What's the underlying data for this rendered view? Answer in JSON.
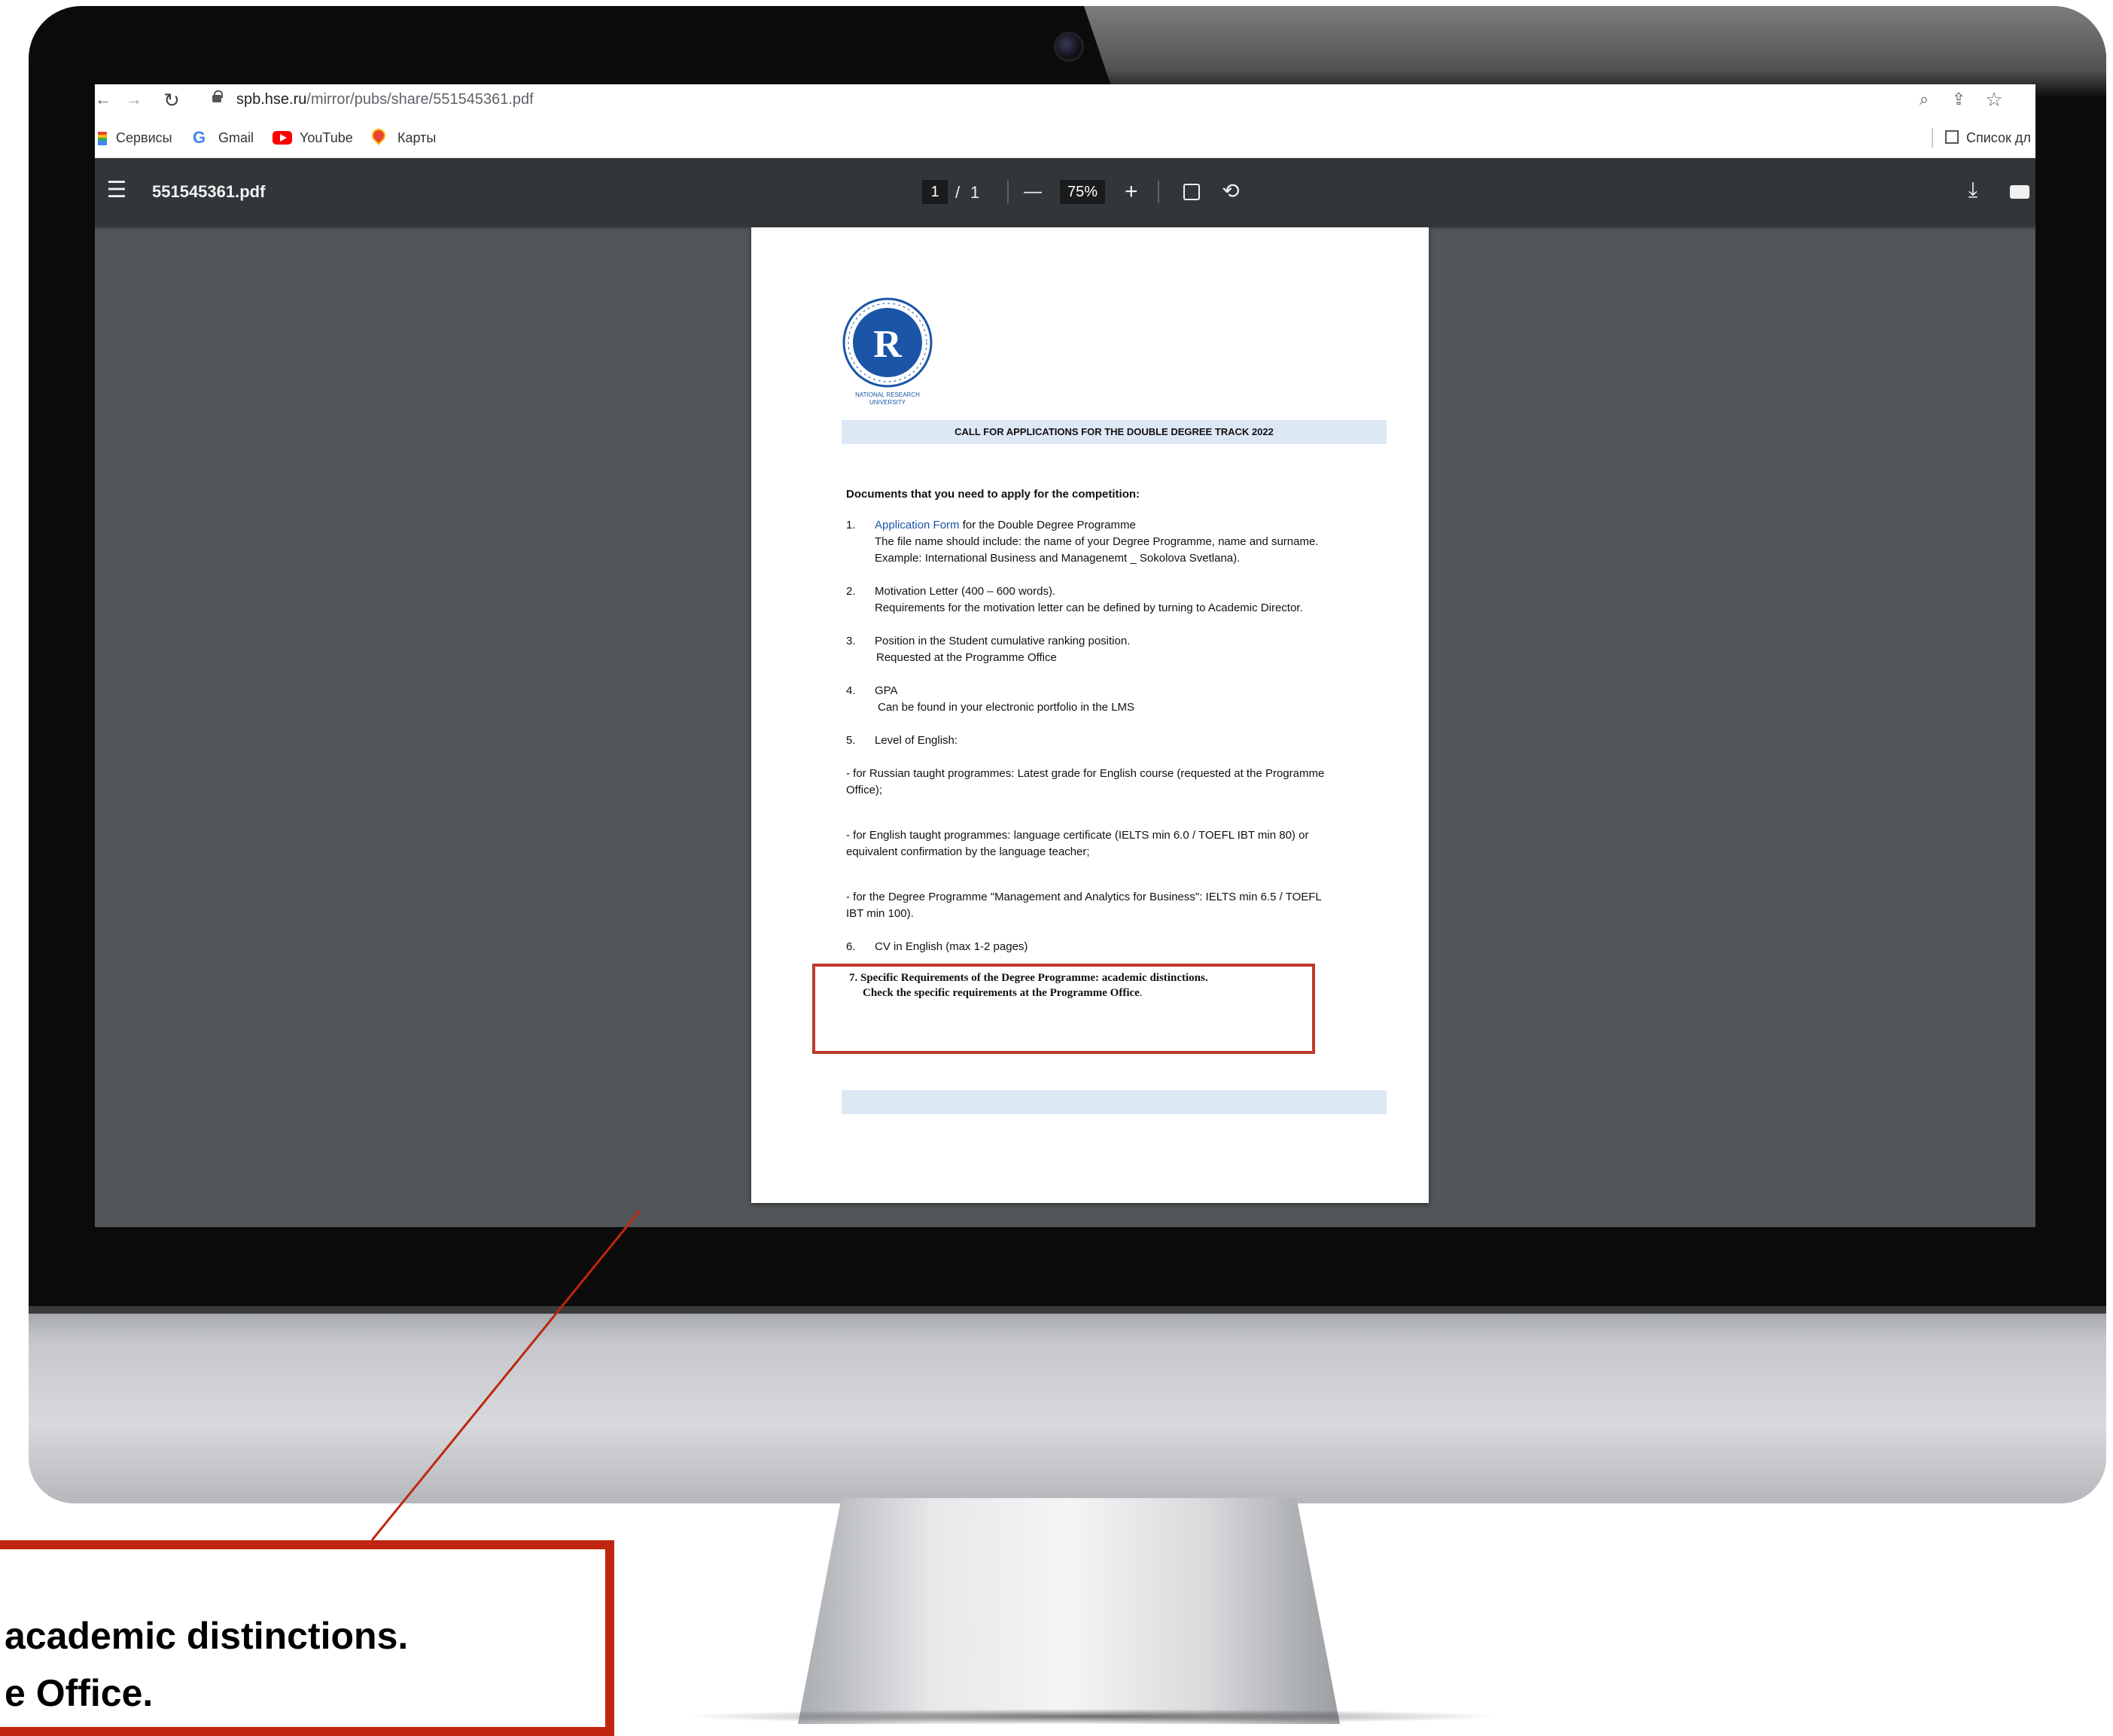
{
  "browser": {
    "url_host": "spb.hse.ru",
    "url_path": "/mirror/pubs/share/551545361.pdf",
    "bookmarks": [
      {
        "label": "Сервисы",
        "icon": "apps-grid-icon"
      },
      {
        "label": "Gmail",
        "icon": "google-icon"
      },
      {
        "label": "YouTube",
        "icon": "youtube-icon"
      },
      {
        "label": "Карты",
        "icon": "maps-pin-icon"
      }
    ],
    "reading_list": "Список дл"
  },
  "pdf_viewer": {
    "filename": "551545361.pdf",
    "current_page": "1",
    "page_separator": "/",
    "total_pages": "1",
    "zoom": "75%",
    "zoom_out_symbol": "—",
    "zoom_in_symbol": "+"
  },
  "document": {
    "logo_caption_1": "NATIONAL RESEARCH",
    "logo_caption_2": "UNIVERSITY",
    "title": "CALL FOR APPLICATIONS FOR THE DOUBLE DEGREE TRACK 2022",
    "heading": "Documents that you need to apply for the competition:",
    "item1_num": "1.",
    "item1_link": "Application Form",
    "item1_rest": " for the Double Degree Programme",
    "item1_line2": "The file name should include: the name of your Degree Programme, name and surname.",
    "item1_line3": "Example: International Business and Managenemt _ Sokolova Svetlana).",
    "item2_num": "2.",
    "item2_line1": "Motivation Letter (400 – 600 words).",
    "item2_line2": "Requirements for the motivation letter can be defined by turning to Academic Director.",
    "item3_num": "3.",
    "item3_line1": "Position in the Student cumulative ranking position.",
    "item3_line2": "Requested at the Programme Office",
    "item4_num": "4.",
    "item4_line1": "GPA",
    "item4_line2": "Can be found in your electronic portfolio in the LMS",
    "item5_num": "5.",
    "item5_line1": "Level of English:",
    "eng1_line1": "- for Russian taught programmes: Latest grade for English course (requested at the Programme",
    "eng1_line2": "Office);",
    "eng2_line1": "- for English taught programmes: language certificate (IELTS min 6.0 / TOEFL IBT min 80) or",
    "eng2_line2": "equivalent confirmation by the language teacher;",
    "eng3_line1": "- for the Degree Programme \"Management and Analytics for Business\": IELTS min 6.5 / TOEFL",
    "eng3_line2": "IBT min 100).",
    "item6_num": "6.",
    "item6_line1": "CV in English (max 1-2 pages)",
    "item7_line1": "7. Specific Requirements of the Degree Programme: academic distinctions.",
    "item7_line2": "Check the specific requirements at the Programme Office",
    "item7_line2_end": "."
  },
  "callout": {
    "line1": "academic distinctions.",
    "line2": "e Office."
  },
  "colors": {
    "highlight": "#c0260f",
    "title_band": "#dde8f5",
    "toolbar": "#323639",
    "viewer_bg": "#525659"
  }
}
